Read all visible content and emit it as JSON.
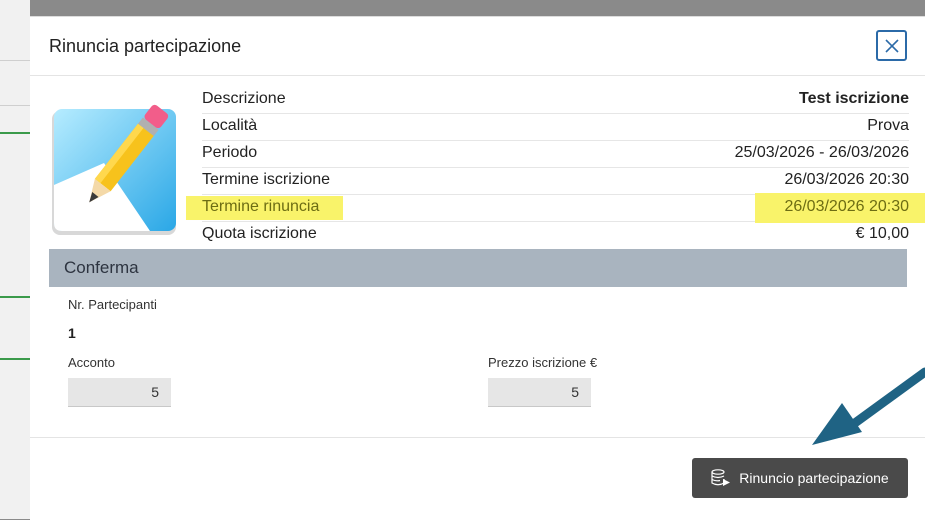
{
  "modal": {
    "title": "Rinuncia partecipazione"
  },
  "info": [
    {
      "label": "Descrizione",
      "value": "Test iscrizione"
    },
    {
      "label": "Località",
      "value": "Prova"
    },
    {
      "label": "Periodo",
      "value": "25/03/2026 - 26/03/2026"
    },
    {
      "label": "Termine iscrizione",
      "value": "26/03/2026 20:30"
    },
    {
      "label": "Termine rinuncia",
      "value": "26/03/2026 20:30"
    },
    {
      "label": "Quota iscrizione",
      "value": "€ 10,00"
    }
  ],
  "confirm": {
    "section_title": "Conferma",
    "participants_label": "Nr. Partecipanti",
    "participants_value": "1",
    "deposit_label": "Acconto",
    "deposit_value": "5",
    "price_label": "Prezzo iscrizione €",
    "price_value": "5"
  },
  "footer": {
    "action_label": "Rinuncio partecipazione"
  },
  "colors": {
    "highlight": "#f9f36a",
    "section_bar": "#a9b4bf",
    "action_button": "#4a4a4a",
    "arrow": "#1f6384",
    "close_border": "#2b6aa8"
  }
}
